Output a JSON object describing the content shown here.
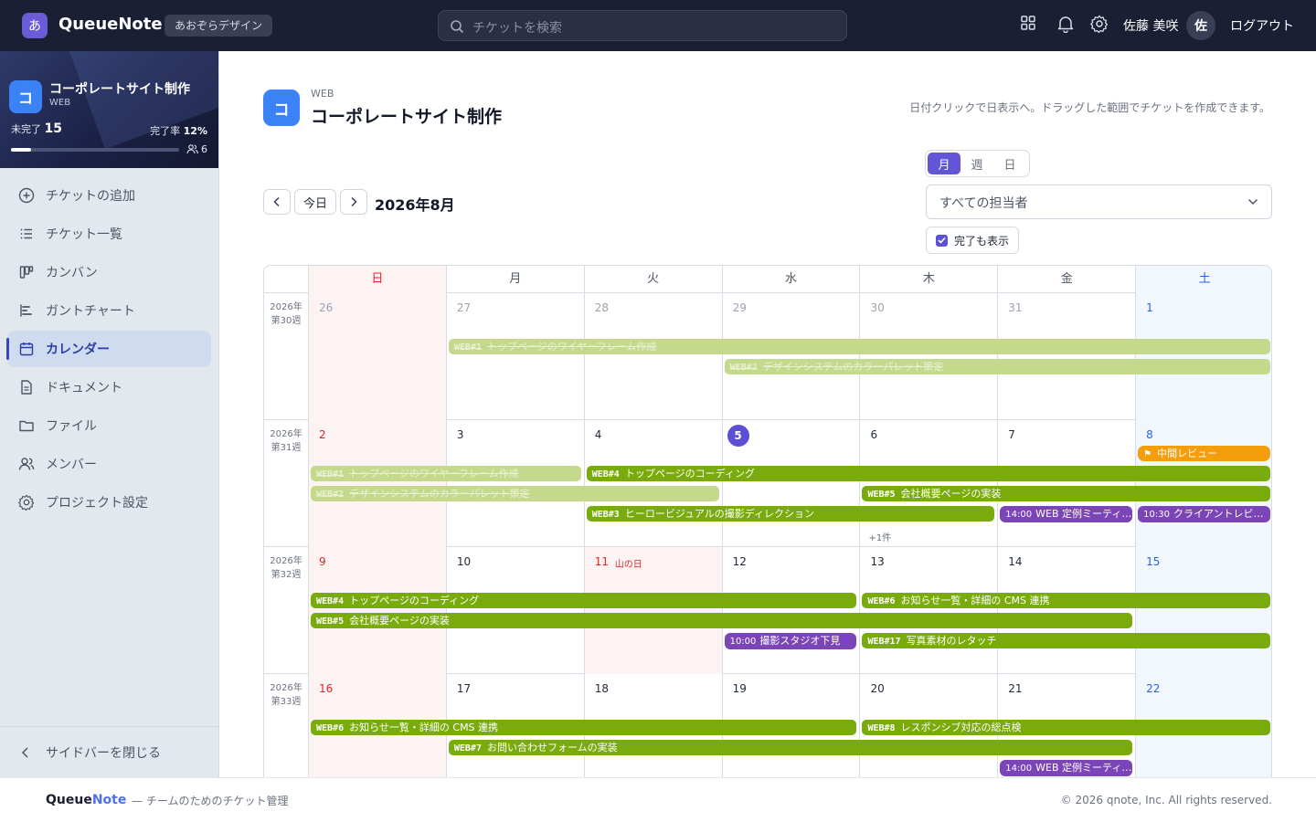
{
  "topbar": {
    "logo_letter": "あ",
    "app_name": "QueueNote",
    "org_name": "あおぞらデザイン",
    "search_placeholder": "チケットを検索",
    "user_name": "佐藤 美咲",
    "user_initial": "佐",
    "logout_label": "ログアウト",
    "icons": [
      "grid-icon",
      "bell-icon",
      "gear-icon"
    ]
  },
  "sidebar": {
    "project": {
      "icon_letter": "コ",
      "name": "コーポレートサイト制作",
      "code": "WEB",
      "open_label": "未完了",
      "open_count": "15",
      "rate_label": "完了率",
      "rate_value": "12%",
      "progress_fraction": 0.12,
      "member_count": "6"
    },
    "items": [
      {
        "label": "チケットの追加",
        "icon": "plus-circle-icon"
      },
      {
        "label": "チケット一覧",
        "icon": "list-icon"
      },
      {
        "label": "カンバン",
        "icon": "kanban-icon"
      },
      {
        "label": "ガントチャート",
        "icon": "gantt-icon"
      },
      {
        "label": "カレンダー",
        "icon": "calendar-icon",
        "active": true
      },
      {
        "label": "ドキュメント",
        "icon": "document-icon"
      },
      {
        "label": "ファイル",
        "icon": "folder-icon"
      },
      {
        "label": "メンバー",
        "icon": "users-icon"
      },
      {
        "label": "プロジェクト設定",
        "icon": "gear-icon"
      }
    ],
    "collapse_label": "サイドバーを閉じる"
  },
  "header": {
    "icon_letter": "コ",
    "code": "WEB",
    "title": "コーポレートサイト制作",
    "hint": "日付クリックで日表示へ。ドラッグした範囲でチケットを作成できます。"
  },
  "toolbar": {
    "today_label": "今日",
    "month_label": "2026年8月",
    "views": [
      "月",
      "週",
      "日"
    ],
    "active_view": "月",
    "assignee_filter": "すべての担当者",
    "show_done_label": "完了も表示",
    "show_done_checked": true
  },
  "calendar": {
    "weekdays": [
      "日",
      "月",
      "火",
      "水",
      "木",
      "金",
      "土"
    ],
    "weeks": [
      {
        "year": "2026年",
        "week": "第30週",
        "days": [
          {
            "d": "26",
            "out": true
          },
          {
            "d": "27",
            "out": true
          },
          {
            "d": "28",
            "out": true
          },
          {
            "d": "29",
            "out": true
          },
          {
            "d": "30",
            "out": true
          },
          {
            "d": "31",
            "out": true
          },
          {
            "d": "1"
          }
        ],
        "events": [
          {
            "key": "WEB#1",
            "title": "トップページのワイヤーフレーム作成",
            "start": 1,
            "end": 6,
            "row": 0,
            "kind": "done"
          },
          {
            "key": "WEB#2",
            "title": "デザインシステムのカラーパレット策定",
            "start": 3,
            "end": 6,
            "row": 1,
            "kind": "done"
          }
        ]
      },
      {
        "year": "2026年",
        "week": "第31週",
        "days": [
          {
            "d": "2"
          },
          {
            "d": "3"
          },
          {
            "d": "4"
          },
          {
            "d": "5",
            "today": true
          },
          {
            "d": "6"
          },
          {
            "d": "7"
          },
          {
            "d": "8"
          }
        ],
        "more": {
          "col": 4,
          "label": "+1件"
        },
        "events": [
          {
            "icon": "flag-icon",
            "title": "中間レビュー",
            "start": 6,
            "end": 6,
            "row": -1,
            "kind": "milestone"
          },
          {
            "key": "WEB#1",
            "title": "トップページのワイヤーフレーム作成",
            "start": 0,
            "end": 1,
            "row": 0,
            "kind": "done"
          },
          {
            "key": "WEB#4",
            "title": "トップページのコーディング",
            "start": 2,
            "end": 6,
            "row": 0,
            "kind": "green"
          },
          {
            "key": "WEB#2",
            "title": "デザインシステムのカラーパレット策定",
            "start": 0,
            "end": 2,
            "row": 1,
            "kind": "done"
          },
          {
            "key": "WEB#5",
            "title": "会社概要ページの実装",
            "start": 4,
            "end": 6,
            "row": 1,
            "kind": "green"
          },
          {
            "key": "WEB#3",
            "title": "ヒーロービジュアルの撮影ディレクション",
            "start": 2,
            "end": 4,
            "row": 2,
            "kind": "green"
          },
          {
            "time": "14:00",
            "title": "WEB 定例ミーティング",
            "start": 5,
            "end": 5,
            "row": 2,
            "kind": "meeting"
          },
          {
            "time": "10:30",
            "title": "クライアントレビュー",
            "start": 6,
            "end": 6,
            "row": 2,
            "kind": "meeting"
          }
        ]
      },
      {
        "year": "2026年",
        "week": "第32週",
        "days": [
          {
            "d": "9"
          },
          {
            "d": "10"
          },
          {
            "d": "11",
            "holiday": "山の日"
          },
          {
            "d": "12"
          },
          {
            "d": "13"
          },
          {
            "d": "14"
          },
          {
            "d": "15"
          }
        ],
        "events": [
          {
            "key": "WEB#4",
            "title": "トップページのコーディング",
            "start": 0,
            "end": 3,
            "row": 0,
            "kind": "green"
          },
          {
            "key": "WEB#6",
            "title": "お知らせ一覧・詳細の CMS 連携",
            "start": 4,
            "end": 6,
            "row": 0,
            "kind": "green"
          },
          {
            "key": "WEB#5",
            "title": "会社概要ページの実装",
            "start": 0,
            "end": 5,
            "row": 1,
            "kind": "green"
          },
          {
            "time": "10:00",
            "title": "撮影スタジオ下見",
            "start": 3,
            "end": 3,
            "row": 2,
            "kind": "meeting"
          },
          {
            "key": "WEB#17",
            "title": "写真素材のレタッチ",
            "start": 4,
            "end": 6,
            "row": 2,
            "kind": "green"
          }
        ]
      },
      {
        "year": "2026年",
        "week": "第33週",
        "days": [
          {
            "d": "16"
          },
          {
            "d": "17"
          },
          {
            "d": "18"
          },
          {
            "d": "19"
          },
          {
            "d": "20"
          },
          {
            "d": "21"
          },
          {
            "d": "22"
          }
        ],
        "events": [
          {
            "key": "WEB#6",
            "title": "お知らせ一覧・詳細の CMS 連携",
            "start": 0,
            "end": 3,
            "row": 0,
            "kind": "green"
          },
          {
            "key": "WEB#8",
            "title": "レスポンシブ対応の総点検",
            "start": 4,
            "end": 6,
            "row": 0,
            "kind": "green"
          },
          {
            "key": "WEB#7",
            "title": "お問い合わせフォームの実装",
            "start": 1,
            "end": 5,
            "row": 1,
            "kind": "green"
          },
          {
            "time": "14:00",
            "title": "WEB 定例ミーティング",
            "start": 5,
            "end": 5,
            "row": 2,
            "kind": "meeting"
          }
        ]
      }
    ]
  },
  "footer": {
    "brand_a": "Queue",
    "brand_b": "Note",
    "tagline": "— チームのためのチケット管理",
    "copyright": "© 2026 qnote, Inc. All rights reserved."
  }
}
